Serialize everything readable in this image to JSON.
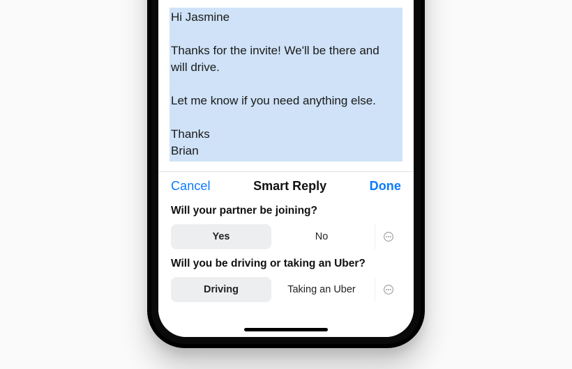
{
  "email": {
    "line1": "Hi Jasmine",
    "line2": "Thanks for the invite! We'll be there and",
    "line3": "will drive.",
    "line4": "Let me know if you need anything else.",
    "line5": "Thanks",
    "line6": "Brian"
  },
  "panel": {
    "cancel": "Cancel",
    "title": "Smart Reply",
    "done": "Done"
  },
  "questions": [
    {
      "label": "Will your partner be joining?",
      "opt1": "Yes",
      "opt2": "No"
    },
    {
      "label": "Will you be driving or taking an Uber?",
      "opt1": "Driving",
      "opt2": "Taking an Uber"
    }
  ]
}
